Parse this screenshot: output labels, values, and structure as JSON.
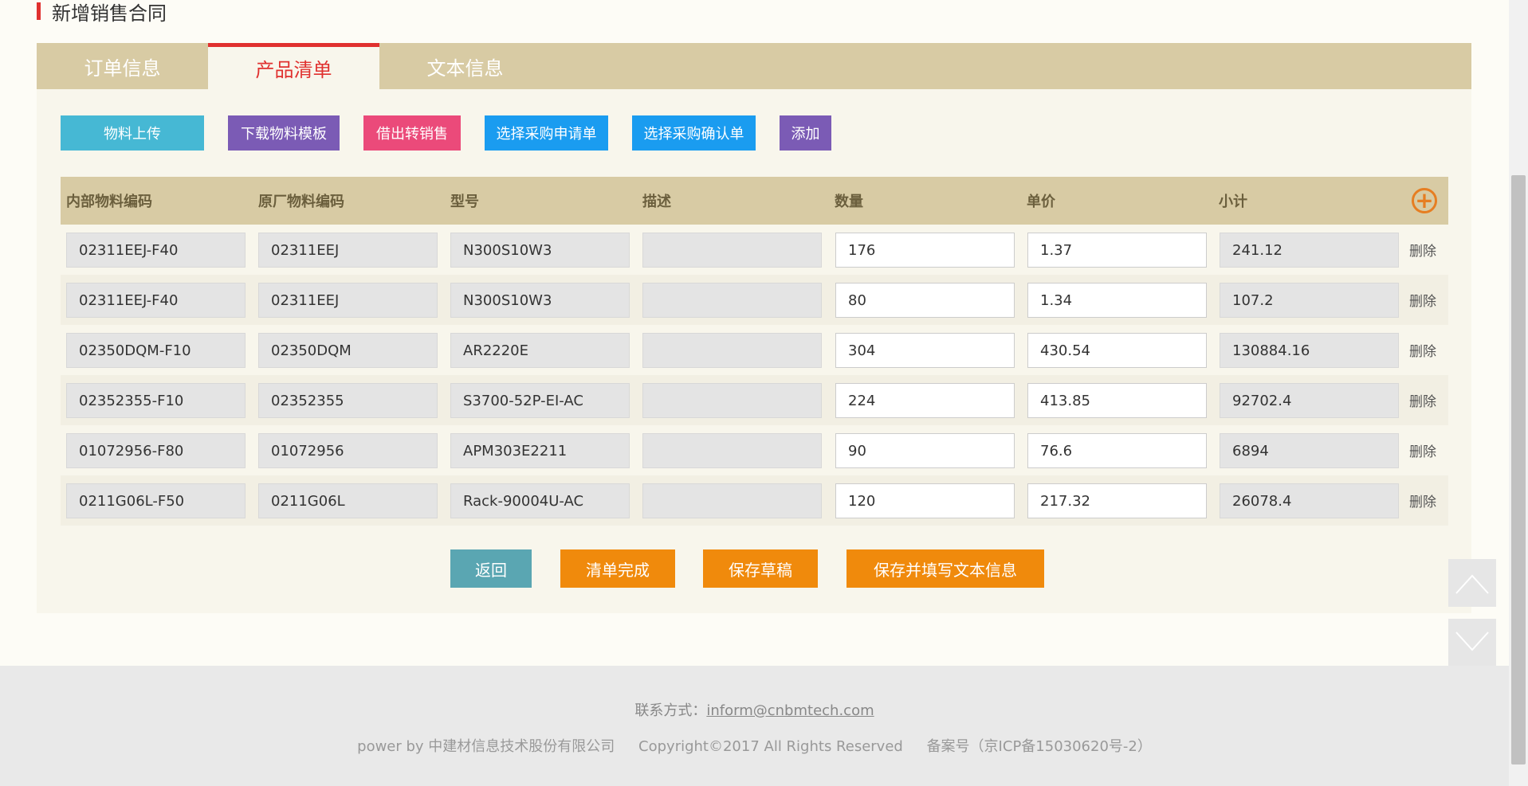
{
  "page_title": "新增销售合同",
  "tabs": [
    {
      "label": "订单信息",
      "active": false
    },
    {
      "label": "产品清单",
      "active": true
    },
    {
      "label": "文本信息",
      "active": false
    }
  ],
  "toolbar": {
    "upload": "物料上传",
    "download_template": "下载物料模板",
    "lend_to_sale": "借出转销售",
    "select_request": "选择采购申请单",
    "select_confirm": "选择采购确认单",
    "add": "添加"
  },
  "table": {
    "headers": [
      "内部物料编码",
      "原厂物料编码",
      "型号",
      "描述",
      "数量",
      "单价",
      "小计"
    ],
    "delete_label": "删除",
    "rows": [
      {
        "internal": "02311EEJ-F40",
        "original": "02311EEJ",
        "model": "N300S10W3",
        "desc": "",
        "qty": "176",
        "price": "1.37",
        "subtotal": "241.12"
      },
      {
        "internal": "02311EEJ-F40",
        "original": "02311EEJ",
        "model": "N300S10W3",
        "desc": "",
        "qty": "80",
        "price": "1.34",
        "subtotal": "107.2"
      },
      {
        "internal": "02350DQM-F10",
        "original": "02350DQM",
        "model": "AR2220E",
        "desc": "",
        "qty": "304",
        "price": "430.54",
        "subtotal": "130884.16"
      },
      {
        "internal": "02352355-F10",
        "original": "02352355",
        "model": "S3700-52P-EI-AC",
        "desc": "",
        "qty": "224",
        "price": "413.85",
        "subtotal": "92702.4"
      },
      {
        "internal": "01072956-F80",
        "original": "01072956",
        "model": "APM303E2211",
        "desc": "",
        "qty": "90",
        "price": "76.6",
        "subtotal": "6894"
      },
      {
        "internal": "0211G06L-F50",
        "original": "0211G06L",
        "model": "Rack-90004U-AC",
        "desc": "",
        "qty": "120",
        "price": "217.32",
        "subtotal": "26078.4"
      }
    ]
  },
  "actions": {
    "back": "返回",
    "finish": "清单完成",
    "save_draft": "保存草稿",
    "save_and_fill": "保存并填写文本信息"
  },
  "footer": {
    "contact_label": "联系方式：",
    "contact_email": "inform@cnbmtech.com",
    "powered_by": "power by 中建材信息技术股份有限公司",
    "copyright": "Copyright©2017 All Rights Reserved",
    "icp": "备案号（京ICP备15030620号-2）"
  },
  "colors": {
    "accent_red": "#e0312f",
    "tab_bar": "#d8cba4",
    "btn_teal": "#46b8d4",
    "btn_purple": "#7b5bb5",
    "btn_pink": "#eb4a7a",
    "btn_blue": "#1a9cf0",
    "btn_back": "#5aa6b2",
    "btn_orange": "#f08a0c"
  },
  "icons": [
    "add-circle-icon",
    "scroll-up-icon",
    "scroll-down-icon"
  ]
}
